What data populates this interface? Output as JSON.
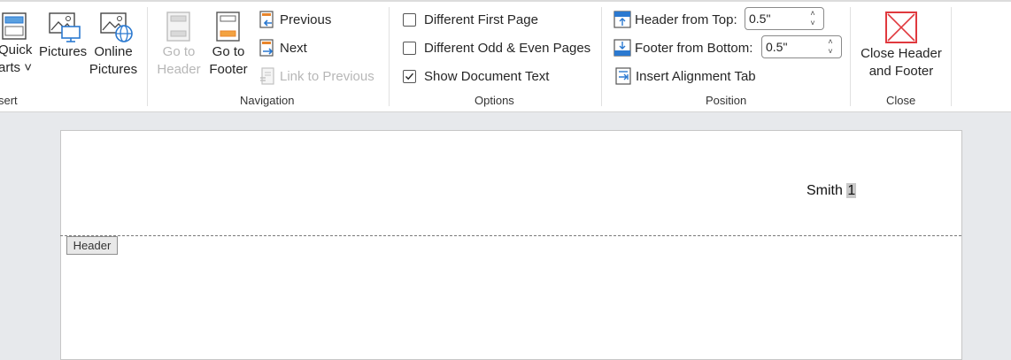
{
  "ribbon": {
    "insert_group": {
      "quick_parts_label": [
        "Quick",
        "arts ˅"
      ],
      "pictures_label": "Pictures",
      "online_pictures_label": [
        "Online",
        "Pictures"
      ],
      "group_label": "sert"
    },
    "navigation": {
      "go_to_header_label": [
        "Go to",
        "Header"
      ],
      "go_to_footer_label": [
        "Go to",
        "Footer"
      ],
      "previous_label": "Previous",
      "next_label": "Next",
      "link_to_previous_label": "Link to Previous",
      "group_label": "Navigation"
    },
    "options": {
      "different_first_page": {
        "label": "Different First Page",
        "checked": false
      },
      "different_odd_even": {
        "label": "Different Odd & Even Pages",
        "checked": false
      },
      "show_document_text": {
        "label": "Show Document Text",
        "checked": true
      },
      "group_label": "Options"
    },
    "position": {
      "header_from_top_label": "Header from Top:",
      "header_from_top_value": "0.5\"",
      "footer_from_bottom_label": "Footer from Bottom:",
      "footer_from_bottom_value": "0.5\"",
      "insert_alignment_tab_label": "Insert Alignment Tab",
      "group_label": "Position"
    },
    "close": {
      "close_label": [
        "Close Header",
        "and Footer"
      ],
      "group_label": "Close"
    }
  },
  "document": {
    "header_text": "Smith ",
    "page_number": "1",
    "header_tag": "Header"
  },
  "colors": {
    "accent_blue": "#2b79d0",
    "accent_orange": "#e8852b",
    "close_red": "#e0393e"
  }
}
